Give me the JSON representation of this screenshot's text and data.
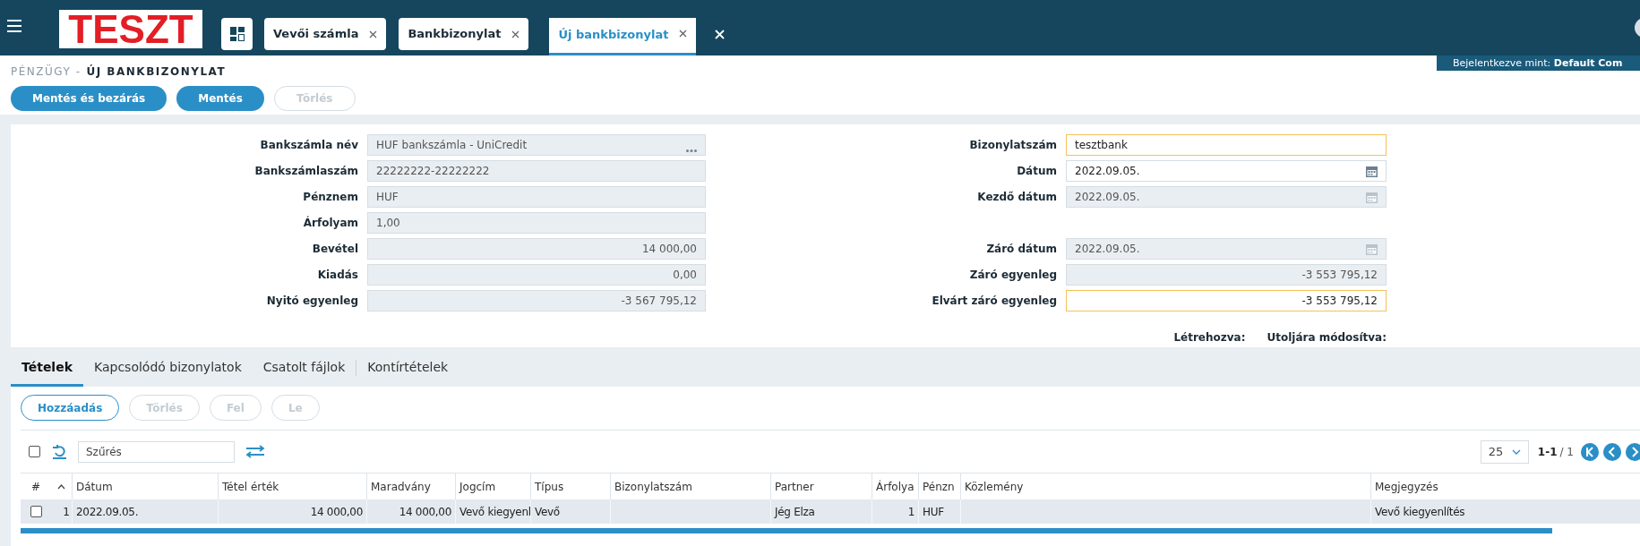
{
  "topbar": {
    "logo": "TESZT",
    "tabs": [
      {
        "label": "Vevői számla",
        "selected": false
      },
      {
        "label": "Bankbizonylat",
        "selected": false
      },
      {
        "label": "Új bankbizonylat",
        "selected": true
      }
    ],
    "user": "Bejelentkezve mint: **Default Com**"
  },
  "breadcrumb": {
    "parent": "PÉNZÜGY -",
    "current": "ÚJ BANKBIZONYLAT"
  },
  "actions": [
    {
      "label": "Mentés és bezárás",
      "disabled": false
    },
    {
      "label": "Mentés",
      "disabled": false
    },
    {
      "label": "Törlés",
      "disabled": true
    }
  ],
  "form": {
    "rows": [
      {
        "left": {
          "label": "Bankszámla név",
          "value": "HUF bankszámla - UniCredit",
          "kind": "lookup",
          "readonly": true,
          "highlighted": false
        },
        "right": {
          "label": "Bizonylatszám",
          "value": "tesztbank",
          "kind": "text",
          "readonly": false,
          "highlighted": true
        }
      },
      {
        "left": {
          "label": "Bankszámlaszám",
          "value": "22222222-22222222",
          "kind": "text",
          "readonly": true,
          "highlighted": false
        },
        "right": {
          "label": "Dátum",
          "value": "2022.09.05.",
          "kind": "date",
          "readonly": false,
          "highlighted": false
        }
      },
      {
        "left": {
          "label": "Pénznem",
          "value": "HUF",
          "kind": "text",
          "readonly": true,
          "highlighted": false
        },
        "right": {
          "label": "Kezdő dátum",
          "value": "2022.09.05.",
          "kind": "date",
          "readonly": true,
          "highlighted": false
        }
      },
      {
        "left": {
          "label": "Árfolyam",
          "value": "1,00",
          "kind": "text",
          "readonly": true,
          "highlighted": false
        }
      },
      {
        "left": {
          "label": "Bevétel",
          "value": "14 000,00",
          "kind": "number",
          "readonly": true,
          "highlighted": false
        },
        "right": {
          "label": "Záró dátum",
          "value": "2022.09.05.",
          "kind": "date",
          "readonly": true,
          "highlighted": false
        }
      },
      {
        "left": {
          "label": "Kiadás",
          "value": "0,00",
          "kind": "number",
          "readonly": true,
          "highlighted": false
        },
        "right": {
          "label": "Záró egyenleg",
          "value": "-3 553 795,12",
          "kind": "number",
          "readonly": true,
          "highlighted": false
        }
      },
      {
        "left": {
          "label": "Nyitó egyenleg",
          "value": "-3 567 795,12",
          "kind": "number",
          "readonly": true,
          "highlighted": false
        },
        "right": {
          "label": "Elvárt záró egyenleg",
          "value": "-3 553 795,12",
          "kind": "number",
          "readonly": false,
          "highlighted": true
        }
      }
    ],
    "meta": [
      "Létrehozva:",
      "Utoljára módosítva:"
    ]
  },
  "detail_tabs": [
    {
      "label": "Tételek",
      "selected": true
    },
    {
      "label": "Kapcsolódó bizonylatok",
      "selected": false
    },
    {
      "label": "Csatolt fájlok",
      "selected": false
    },
    {
      "label": "Kontírtételek",
      "selected": false
    }
  ],
  "detail_actions": [
    {
      "label": "Hozzáadás",
      "disabled": false
    },
    {
      "label": "Törlés",
      "disabled": true
    },
    {
      "label": "Fel",
      "disabled": true
    },
    {
      "label": "Le",
      "disabled": true
    }
  ],
  "filter": {
    "placeholder": "Szűrés"
  },
  "pager": {
    "page_size": "25",
    "range": "1-1",
    "total": "/ 1"
  },
  "table": {
    "columns": [
      {
        "label": "Dátum",
        "kind": "text"
      },
      {
        "label": "Tétel érték",
        "kind": "number"
      },
      {
        "label": "Maradvány",
        "kind": "number"
      },
      {
        "label": "Jogcím",
        "kind": "text"
      },
      {
        "label": "Típus",
        "kind": "text"
      },
      {
        "label": "Bizonylatszám",
        "kind": "text"
      },
      {
        "label": "Partner",
        "kind": "text"
      },
      {
        "label": "Árfolya",
        "kind": "number"
      },
      {
        "label": "Pénzn",
        "kind": "text"
      },
      {
        "label": "Közlemény",
        "kind": "text"
      },
      {
        "label": "Megjegyzés",
        "kind": "text"
      }
    ],
    "select_all": {
      "checked": false
    },
    "number_header": "#",
    "rows": [
      {
        "number": "1",
        "checked": false,
        "cells": [
          "2022.09.05.",
          "14 000,00",
          "14 000,00",
          "Vevő kiegyenl",
          "Vevő",
          "",
          "Jég Elza",
          "1",
          "HUF",
          "",
          "Vevő kiegyenlítés"
        ]
      }
    ]
  }
}
